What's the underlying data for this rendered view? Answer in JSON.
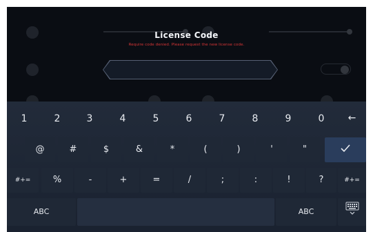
{
  "dialog": {
    "title": "License Code",
    "hint": "Require code denied. Please request the new license code."
  },
  "keyboard": {
    "row1": [
      "1",
      "2",
      "3",
      "4",
      "5",
      "6",
      "7",
      "8",
      "9",
      "0"
    ],
    "backspace_icon": "left-arrow-icon",
    "row2": [
      "@",
      "#",
      "$",
      "&",
      "*",
      "(",
      ")",
      "'",
      "\""
    ],
    "confirm_icon": "checkmark-icon",
    "row3_left": "#+=",
    "row3": [
      "%",
      "-",
      "+",
      "=",
      "/",
      ";",
      ":",
      "!",
      "?"
    ],
    "row3_right": "#+=",
    "abc_left": "ABC",
    "abc_right": "ABC",
    "hide_icon": "keyboard-hide-icon"
  },
  "colors": {
    "background": "#0a0d13",
    "keyboard": "#1f2836",
    "key": "#252f40",
    "accent_key": "#2a3d5c",
    "hint_red": "#d93636"
  }
}
